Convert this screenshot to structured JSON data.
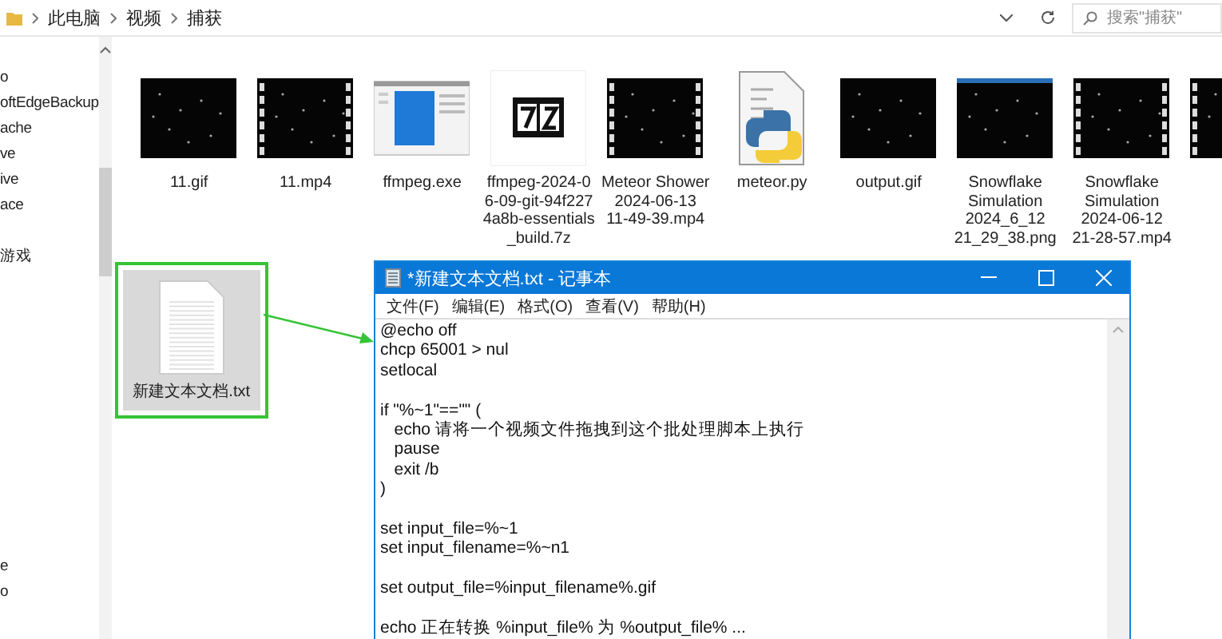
{
  "address_bar": {
    "path": [
      "此电脑",
      "视频",
      "捕获"
    ],
    "search": {
      "placeholder": "搜索\"捕获\""
    }
  },
  "sidebar": {
    "items": [
      "o",
      "oftEdgeBackup",
      "ache",
      "ve",
      "ive",
      "ace",
      "游戏"
    ],
    "bottom_items": [
      "e",
      "o"
    ]
  },
  "files": [
    {
      "kind": "gif",
      "name_lines": [
        "11.gif"
      ],
      "selected": false
    },
    {
      "kind": "video",
      "name_lines": [
        "11.mp4"
      ],
      "selected": false
    },
    {
      "kind": "exe",
      "name_lines": [
        "ffmpeg.exe"
      ],
      "selected": false
    },
    {
      "kind": "archive",
      "name_lines": [
        "ffmpeg-2024-0",
        "6-09-git-94f227",
        "4a8b-essentials",
        "_build.7z"
      ],
      "selected": false
    },
    {
      "kind": "video",
      "name_lines": [
        "Meteor Shower",
        "2024-06-13",
        "11-49-39.mp4"
      ],
      "selected": false
    },
    {
      "kind": "python",
      "name_lines": [
        "meteor.py"
      ],
      "selected": false
    },
    {
      "kind": "gif",
      "name_lines": [
        "output.gif"
      ],
      "selected": false
    },
    {
      "kind": "png",
      "name_lines": [
        "Snowflake",
        "Simulation",
        "2024_6_12",
        "21_29_38.png"
      ],
      "selected": false
    },
    {
      "kind": "video",
      "name_lines": [
        "Snowflake",
        "Simulation",
        "2024-06-12",
        "21-28-57.mp4"
      ],
      "selected": false
    },
    {
      "kind": "video",
      "selected": false
    },
    {
      "kind": "txt",
      "name_lines": [
        "新建文本文档.txt"
      ],
      "selected": true
    }
  ],
  "notepad": {
    "title": "*新建文本文档.txt - 记事本",
    "menu": [
      "文件(F)",
      "编辑(E)",
      "格式(O)",
      "查看(V)",
      "帮助(H)"
    ],
    "blocks": [
      [
        "@echo off",
        "chcp 65001 > nul",
        "setlocal"
      ],
      [
        "if \"%~1\"==\"\" (",
        "   echo 请将一个视频文件拖拽到这个批处理脚本上执行",
        "   pause",
        "   exit /b",
        ")"
      ],
      [
        "set input_file=%~1",
        "set input_filename=%~n1"
      ],
      [
        "set output_file=%input_filename%.gif"
      ],
      [
        "echo 正在转换 %input_file% 为 %output_file% ..."
      ]
    ]
  }
}
